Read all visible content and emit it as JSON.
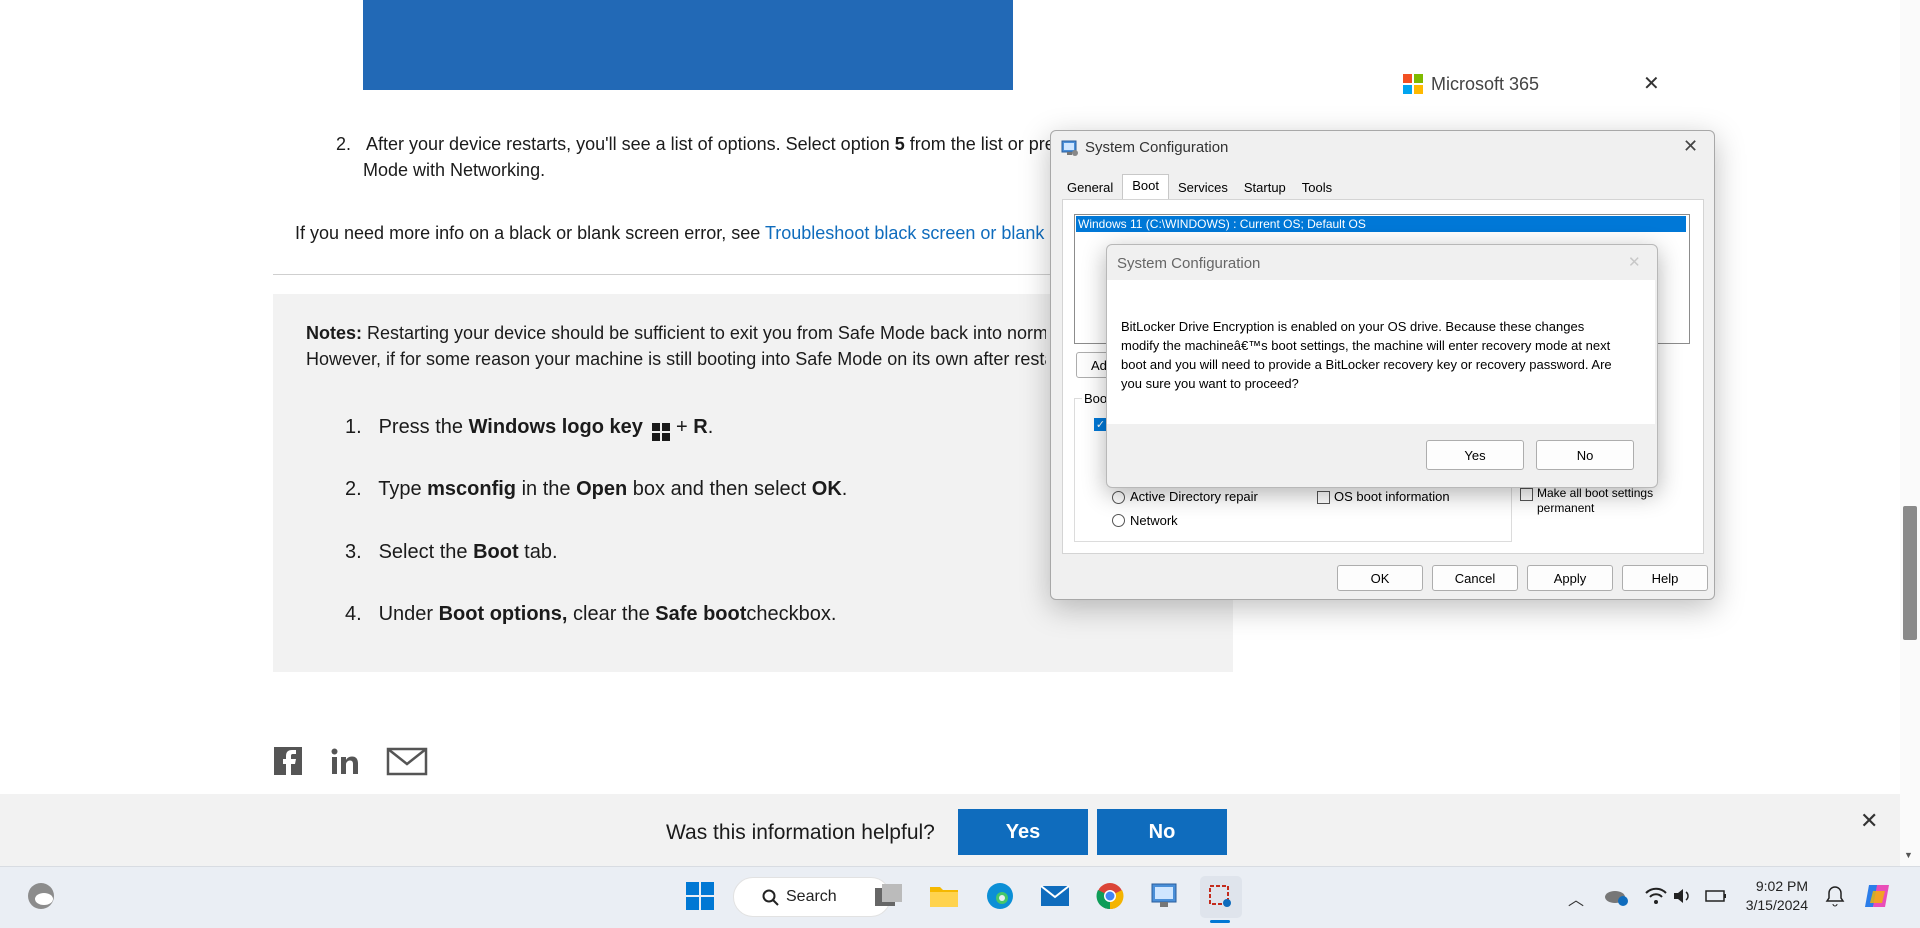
{
  "article": {
    "step2_num": "2.",
    "step2_line1_a": "After your device restarts, you'll see a list of options. Select option ",
    "step2_line1_b": "5",
    "step2_line1_c": " from the list or press",
    "step2_line2": "Mode with Networking.",
    "blank_screen_prefix": "If you need more info on a black or blank screen error, see ",
    "blank_screen_link": "Troubleshoot black screen or blank scre",
    "notes_label": "Notes:",
    "notes_line1": " Restarting your device should be sufficient to exit you from Safe Mode back into normal m",
    "notes_line2": "However, if for some reason your machine is still booting into Safe Mode on its own after restarti",
    "steps": [
      {
        "num": "1.",
        "a": "Press the ",
        "b": "Windows logo key",
        "c": " + ",
        "d": "R",
        "e": "."
      },
      {
        "num": "2.",
        "a": "Type ",
        "b": "msconfig",
        "c": " in the ",
        "d": "Open",
        "e": " box and then select ",
        "f": "OK",
        "g": "."
      },
      {
        "num": "3.",
        "a": "Select the ",
        "b": "Boot",
        "c": " tab."
      },
      {
        "num": "4.",
        "a": "Under ",
        "b": "Boot options,",
        "c": " clear the ",
        "d": "Safe boot",
        "e": "checkbox."
      }
    ]
  },
  "m365": {
    "label": "Microsoft 365",
    "colors": [
      "#f25022",
      "#7fba00",
      "#00a4ef",
      "#ffb900"
    ]
  },
  "feedback": {
    "question": "Was this information helpful?",
    "yes": "Yes",
    "no": "No"
  },
  "sysconfig": {
    "title": "System Configuration",
    "tabs": [
      "General",
      "Boot",
      "Services",
      "Startup",
      "Tools"
    ],
    "active_tab": "Boot",
    "os_entry": "Windows 11 (C:\\WINDOWS) : Current OS; Default OS",
    "advanced_partial": "Ad",
    "boot_partial": "Boot",
    "options": {
      "ad_repair": "Active Directory repair",
      "network": "Network",
      "os_boot_info": "OS boot information",
      "make_permanent": "Make all boot settings permanent"
    },
    "buttons": {
      "ok": "OK",
      "cancel": "Cancel",
      "apply": "Apply",
      "help": "Help"
    }
  },
  "dialog": {
    "title": "System Configuration",
    "message": "BitLocker Drive Encryption is enabled on your OS drive. Because these changes modify the machineâ€™s boot settings, the machine will enter recovery mode at next boot and you will need to provide a BitLocker recovery key or recovery password. Are you sure you want to proceed?",
    "yes": "Yes",
    "no": "No"
  },
  "taskbar": {
    "search": "Search",
    "time": "9:02 PM",
    "date": "3/15/2024",
    "accent": "#0078d4"
  }
}
